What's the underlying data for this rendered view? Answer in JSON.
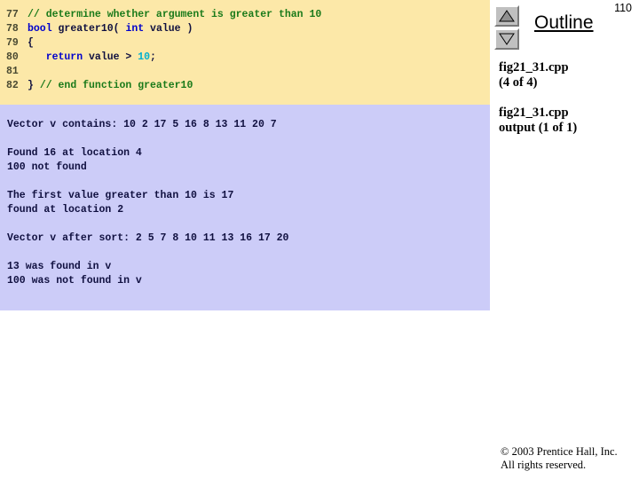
{
  "slide": {
    "page_number": "110"
  },
  "code_panel": {
    "background_color": "#fce8a8",
    "lines": [
      {
        "number": "77",
        "tokens": [
          {
            "text": "// determine whether argument is greater than 10",
            "type": "cmt"
          }
        ]
      },
      {
        "number": "78",
        "tokens": [
          {
            "text": "bool ",
            "type": "kw"
          },
          {
            "text": "greater10( ",
            "type": "plain"
          },
          {
            "text": "int ",
            "type": "kw"
          },
          {
            "text": "value )",
            "type": "plain"
          }
        ]
      },
      {
        "number": "79",
        "tokens": [
          {
            "text": "{",
            "type": "plain"
          }
        ]
      },
      {
        "number": "80",
        "tokens": [
          {
            "text": "   return ",
            "type": "kw"
          },
          {
            "text": "value > ",
            "type": "plain"
          },
          {
            "text": "10",
            "type": "num"
          },
          {
            "text": ";",
            "type": "plain"
          }
        ]
      },
      {
        "number": "81",
        "tokens": [
          {
            "text": "",
            "type": "plain"
          }
        ]
      },
      {
        "number": "82",
        "tokens": [
          {
            "text": "} ",
            "type": "plain"
          },
          {
            "text": "// end function greater10",
            "type": "cmt"
          }
        ]
      }
    ]
  },
  "output_panel": {
    "background_color": "#ccccf8",
    "lines": [
      "Vector v contains: 10 2 17 5 16 8 13 11 20 7",
      "",
      "Found 16 at location 4",
      "100 not found",
      "",
      "The first value greater than 10 is 17",
      "found at location 2",
      "",
      "Vector v after sort: 2 5 7 8 10 11 13 16 17 20",
      "",
      "13 was found in v",
      "100 was not found in v"
    ]
  },
  "sidebar": {
    "title": "Outline",
    "scroll_up_label": "scroll-up",
    "scroll_down_label": "scroll-down",
    "entries": [
      "fig21_31.cpp\n(4 of 4)",
      "fig21_31.cpp\noutput (1 of 1)"
    ]
  },
  "footer": {
    "copyright": "© 2003 Prentice Hall, Inc.",
    "rights": "All rights reserved."
  }
}
